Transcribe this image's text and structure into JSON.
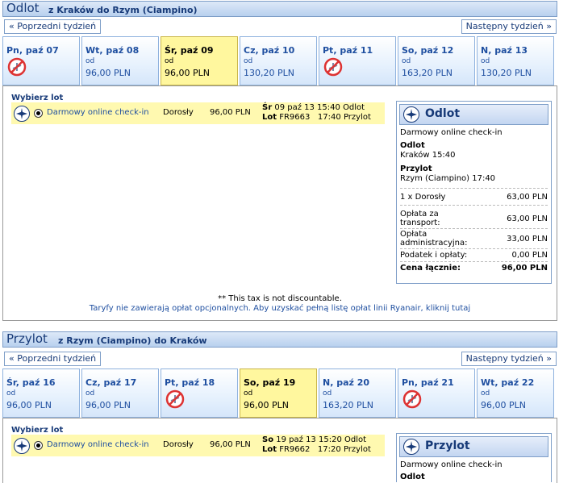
{
  "outbound": {
    "title": "Odlot",
    "route": "z Kraków do Rzym (Ciampino)",
    "prev_week": "« Poprzedni tydzień",
    "next_week": "Następny tydzień »",
    "tabs": [
      {
        "day": "Pn, paź 07",
        "od": "",
        "price": "",
        "no_flight": true
      },
      {
        "day": "Wt, paź 08",
        "od": "od",
        "price": "96,00 PLN",
        "no_flight": false
      },
      {
        "day": "Śr, paź 09",
        "od": "od",
        "price": "96,00 PLN",
        "no_flight": false,
        "selected": true
      },
      {
        "day": "Cz, paź 10",
        "od": "od",
        "price": "130,20 PLN",
        "no_flight": false
      },
      {
        "day": "Pt, paź 11",
        "od": "",
        "price": "",
        "no_flight": true
      },
      {
        "day": "So, paź 12",
        "od": "od",
        "price": "163,20 PLN",
        "no_flight": false
      },
      {
        "day": "N, paź 13",
        "od": "od",
        "price": "130,20 PLN",
        "no_flight": false
      }
    ],
    "choose_label": "Wybierz lot",
    "flight": {
      "fare": "Darmowy online check-in",
      "passenger": "Dorosły",
      "price": "96,00 PLN",
      "dep_day": "Śr",
      "dep_date": "09 paź 13",
      "dep_time": "15:40",
      "dep_label": "Odlot",
      "lot_label": "Lot",
      "flight_no": "FR9663",
      "arr_time": "17:40",
      "arr_label": "Przylot"
    },
    "summary": {
      "title": "Odlot",
      "fare": "Darmowy online check-in",
      "dep_label": "Odlot",
      "dep_value": "Kraków 15:40",
      "arr_label": "Przylot",
      "arr_value": "Rzym (Ciampino) 17:40",
      "pax_label": "1 x Dorosły",
      "pax_value": "63,00 PLN",
      "transport_label": "Opłata za transport:",
      "transport_value": "63,00 PLN",
      "admin_label": "Opłata administracyjna:",
      "admin_value": "33,00 PLN",
      "tax_label": "Podatek i opłaty:",
      "tax_value": "0,00 PLN",
      "total_label": "Cena łącznie:",
      "total_value": "96,00 PLN"
    },
    "tax_note": "** This tax is not discountable.",
    "fees_note": "Taryfy nie zawierają opłat opcjonalnych. Aby uzyskać pełną listę opłat linii Ryanair, kliknij tutaj"
  },
  "inbound": {
    "title": "Przylot",
    "route": "z Rzym (Ciampino) do Kraków",
    "prev_week": "« Poprzedni tydzień",
    "next_week": "Następny tydzień »",
    "tabs": [
      {
        "day": "Śr, paź 16",
        "od": "od",
        "price": "96,00 PLN",
        "no_flight": false
      },
      {
        "day": "Cz, paź 17",
        "od": "od",
        "price": "96,00 PLN",
        "no_flight": false
      },
      {
        "day": "Pt, paź 18",
        "od": "",
        "price": "",
        "no_flight": true
      },
      {
        "day": "So, paź 19",
        "od": "od",
        "price": "96,00 PLN",
        "no_flight": false,
        "selected": true
      },
      {
        "day": "N, paź 20",
        "od": "od",
        "price": "163,20 PLN",
        "no_flight": false
      },
      {
        "day": "Pn, paź 21",
        "od": "",
        "price": "",
        "no_flight": true
      },
      {
        "day": "Wt, paź 22",
        "od": "od",
        "price": "96,00 PLN",
        "no_flight": false
      }
    ],
    "choose_label": "Wybierz lot",
    "flight": {
      "fare": "Darmowy online check-in",
      "passenger": "Dorosły",
      "price": "96,00 PLN",
      "dep_day": "So",
      "dep_date": "19 paź 13",
      "dep_time": "15:20",
      "dep_label": "Odlot",
      "lot_label": "Lot",
      "flight_no": "FR9662",
      "arr_time": "17:20",
      "arr_label": "Przylot"
    },
    "summary": {
      "title": "Przylot",
      "fare": "Darmowy online check-in",
      "dep_label": "Odlot"
    }
  }
}
